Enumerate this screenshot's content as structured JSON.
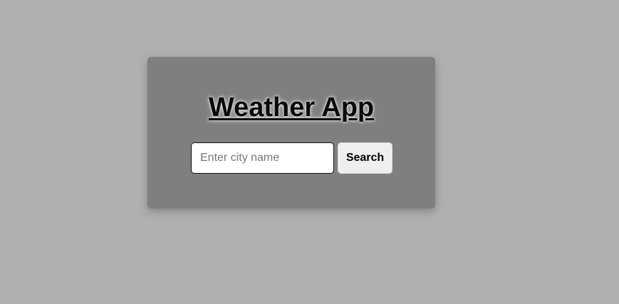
{
  "app": {
    "title": "Weather App"
  },
  "search": {
    "placeholder": "Enter city name",
    "value": "",
    "button_label": "Search"
  }
}
